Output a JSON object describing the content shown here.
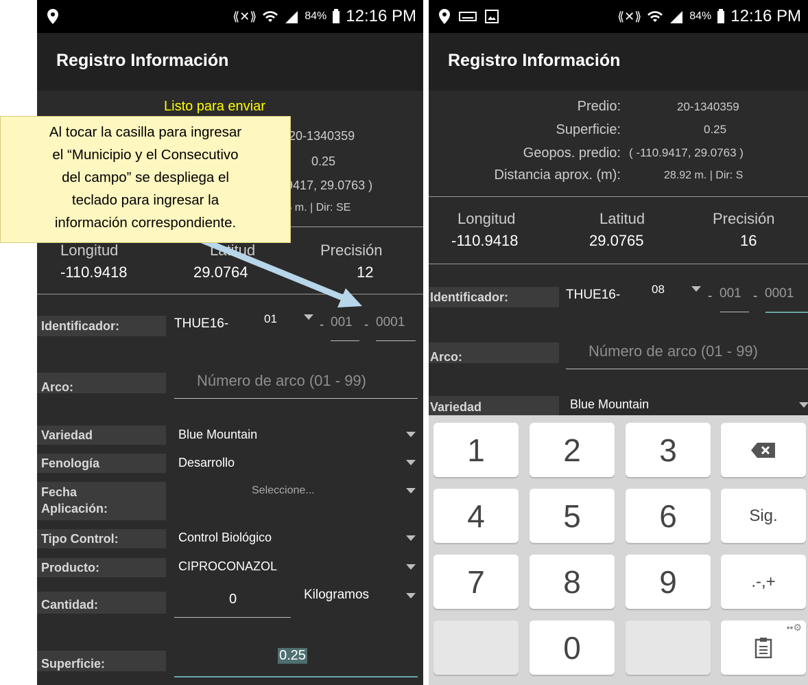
{
  "left": {
    "status": {
      "battery_pct": "84%",
      "time": "12:16 PM"
    },
    "title": "Registro Información",
    "status_msg": "Listo para enviar",
    "predio_value": "20-1340359",
    "superficie_value": "0.25",
    "geopos_value": ".9417, 29.0763 )",
    "distancia_value": ".6 m. | Dir: SE",
    "coords": {
      "lon_label": "Longitud",
      "lon": "-110.9418",
      "lat_label": "Latitud",
      "lat": "29.0764",
      "prec_label": "Precisión",
      "prec": "12"
    },
    "identificador": {
      "label": "Identificador:",
      "prefix": "THUE16-",
      "muni": "01",
      "sep": "-",
      "num": "001",
      "num2": "0001"
    },
    "arco": {
      "label": "Arco:",
      "placeholder": "Número de arco (01 - 99)"
    },
    "variedad": {
      "label": "Variedad",
      "value": "Blue Mountain"
    },
    "fenologia": {
      "label": "Fenología",
      "value": "Desarrollo"
    },
    "fecha": {
      "label1": "Fecha",
      "label2": "Aplicación:",
      "value": "Seleccione..."
    },
    "tipo": {
      "label": "Tipo Control:",
      "value": "Control Biológico"
    },
    "producto": {
      "label": "Producto:",
      "value": "CIPROCONAZOL"
    },
    "cantidad": {
      "label": "Cantidad:",
      "value": "0",
      "unit": "Kilogramos"
    },
    "superficie": {
      "label": "Superficie:",
      "value": "0.25"
    }
  },
  "callout": {
    "lines": [
      "Al tocar la casilla para ingresar",
      "el “Municipio y el Consecutivo",
      "del campo” se despliega el",
      "teclado para ingresar la",
      "información correspondiente."
    ]
  },
  "right": {
    "status": {
      "battery_pct": "84%",
      "time": "12:16 PM"
    },
    "title": "Registro Información",
    "predio": {
      "label": "Predio:",
      "value": "20-1340359"
    },
    "superficie_info": {
      "label": "Superficie:",
      "value": "0.25"
    },
    "geopos": {
      "label": "Geopos. predio:",
      "value": "( -110.9417, 29.0763 )"
    },
    "distancia": {
      "label": "Distancia aprox. (m):",
      "value": "28.92 m. | Dir: S"
    },
    "coords": {
      "lon_label": "Longitud",
      "lon": "-110.9418",
      "lat_label": "Latitud",
      "lat": "29.0765",
      "prec_label": "Precisión",
      "prec": "16"
    },
    "identificador": {
      "label": "Identificador:",
      "prefix": "THUE16-",
      "muni": "08",
      "sep": "-",
      "num": "001",
      "num2": "0001"
    },
    "arco": {
      "label": "Arco:",
      "placeholder": "Número de arco (01 - 99)"
    },
    "variedad": {
      "label": "Variedad",
      "value": "Blue Mountain"
    },
    "keys": [
      "1",
      "2",
      "3",
      "4",
      "5",
      "6",
      "7",
      "8",
      "9",
      "0"
    ],
    "key_sig": "Sig.",
    "key_sym": ".-,+"
  },
  "icons": [
    "location-icon",
    "keyboard-icon",
    "image-icon",
    "vibrate-icon",
    "wifi-icon",
    "signal-icon",
    "battery-icon",
    "backspace-icon",
    "clipboard-icon",
    "settings-icon",
    "dropdown-caret-icon"
  ]
}
